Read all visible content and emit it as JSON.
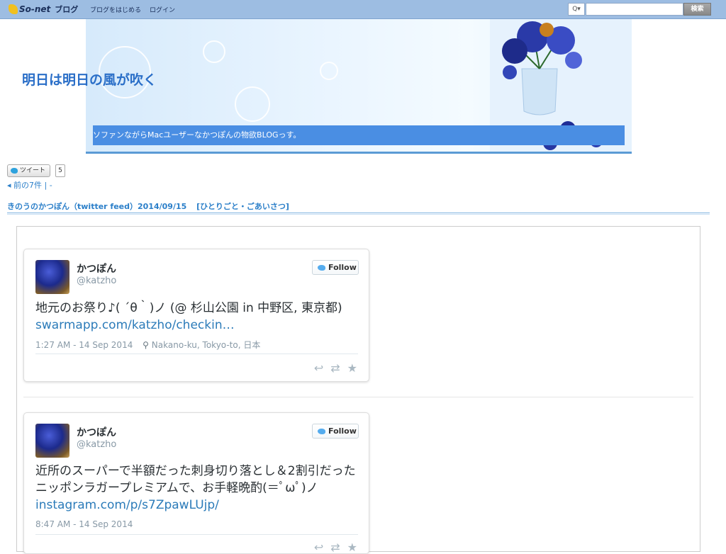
{
  "topbar": {
    "logo_text": "So-net",
    "logo_blog": "ブログ",
    "link_start": "ブログをはじめる",
    "link_login": "ログイン",
    "search_selector": "Q▾",
    "search_placeholder": "",
    "search_button": "検索"
  },
  "header": {
    "site_title": "明日は明日の風が吹く",
    "tagline": "ソファンながらMacユーザーなかつぽんの物欲BLOGっす。"
  },
  "share": {
    "tweet_label": "ツイート",
    "tweet_count": "5"
  },
  "nav": {
    "prev_label": "前の7件",
    "separator": "| -"
  },
  "post": {
    "title": "きのうのかつぽん（twitter feed）2014/09/15",
    "category": "[ひとりごと・ごあいさつ]"
  },
  "tweets": [
    {
      "name": "かつぽん",
      "handle": "@katzho",
      "follow_label": "Follow",
      "text": "地元のお祭り♪( ´θ｀)ノ (@ 杉山公園 in 中野区, 東京都)",
      "link": "swarmapp.com/katzho/checkin…",
      "time": "1:27 AM - 14 Sep 2014",
      "location": "Nakano-ku, Tokyo-to, 日本"
    },
    {
      "name": "かつぽん",
      "handle": "@katzho",
      "follow_label": "Follow",
      "text": "近所のスーパーで半額だった刺身切り落とし＆2割引だったニッポンラガープレミアムで、お手軽晩酌(＝ﾟωﾟ)ノ",
      "link": "instagram.com/p/s7ZpawLUjp/",
      "time": "8:47 AM - 14 Sep 2014",
      "location": ""
    }
  ],
  "colors": {
    "topbar": "#9dbde2",
    "title": "#2b6fc8",
    "tagline_bg": "#4a8ee3",
    "link": "#2b7bb9"
  }
}
